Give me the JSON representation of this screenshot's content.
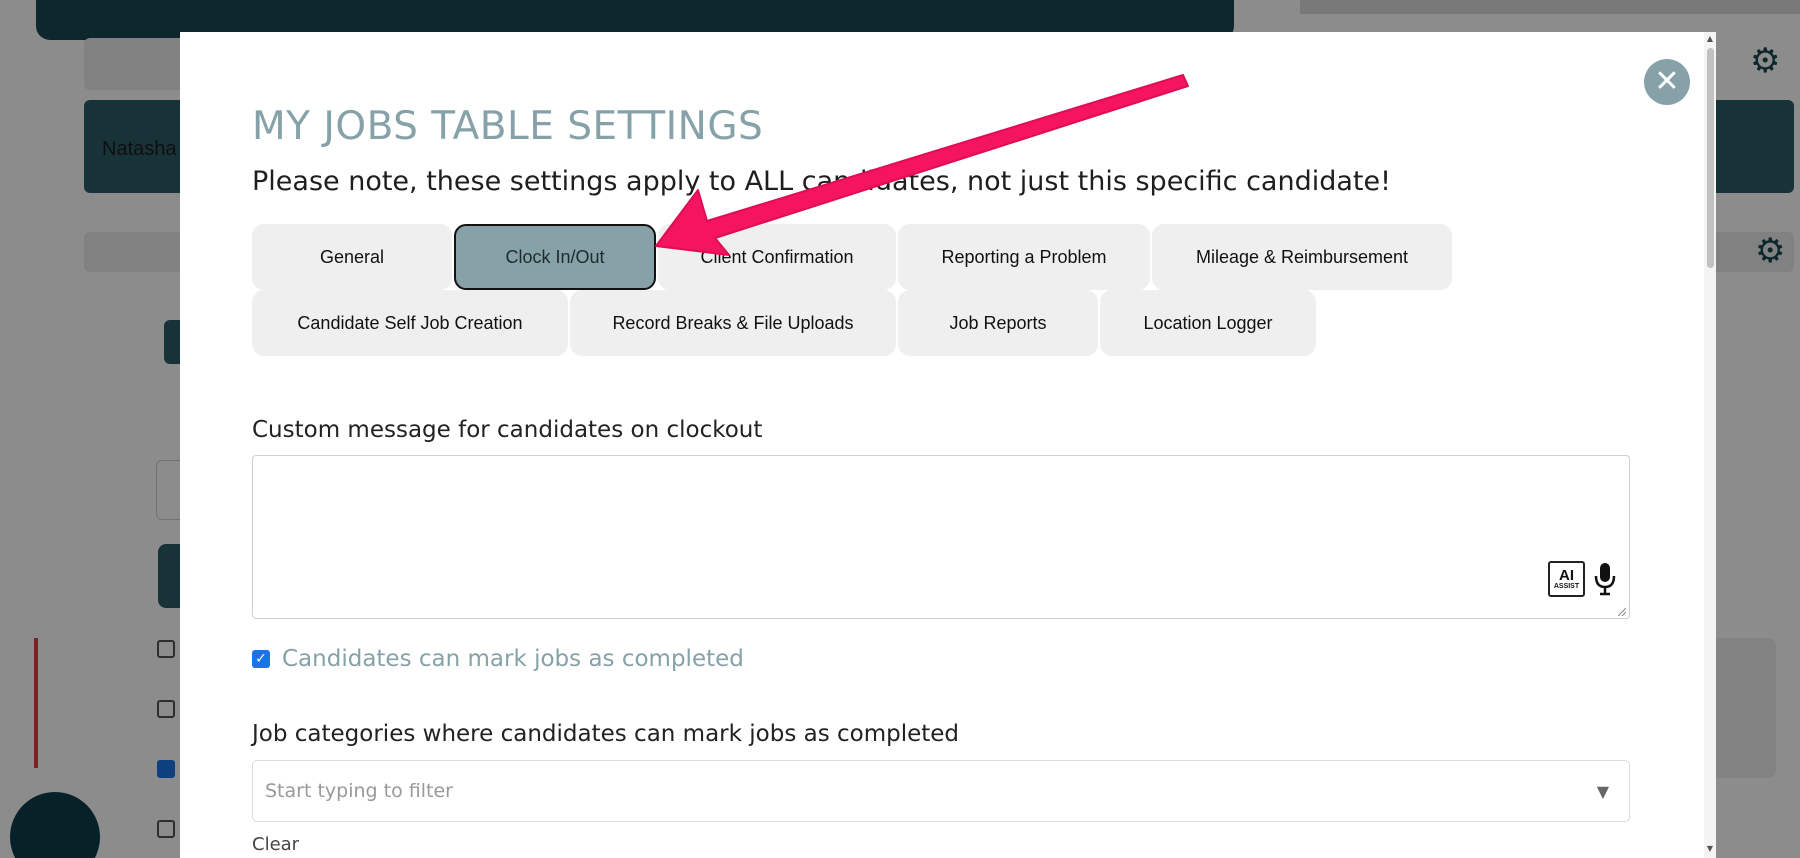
{
  "background": {
    "user_name": "Natasha",
    "gear_icon": "gear-icon"
  },
  "modal": {
    "title": "MY JOBS TABLE SETTINGS",
    "note": "Please note, these settings apply to ALL candidates, not just this specific candidate!",
    "close_icon": "close-icon",
    "tabs": [
      {
        "label": "General",
        "active": false
      },
      {
        "label": "Clock In/Out",
        "active": true
      },
      {
        "label": "Client Confirmation",
        "active": false
      },
      {
        "label": "Reporting a Problem",
        "active": false
      },
      {
        "label": "Mileage & Reimbursement",
        "active": false
      },
      {
        "label": "Candidate Self Job Creation",
        "active": false
      },
      {
        "label": "Record Breaks & File Uploads",
        "active": false
      },
      {
        "label": "Job Reports",
        "active": false
      },
      {
        "label": "Location Logger",
        "active": false
      }
    ],
    "custom_message": {
      "label": "Custom message for candidates on clockout",
      "value": "",
      "ai_assist_big": "AI",
      "ai_assist_small": "ASSIST"
    },
    "completed_checkbox": {
      "label": "Candidates can mark jobs as completed",
      "checked": true
    },
    "job_categories": {
      "label": "Job categories where candidates can mark jobs as completed",
      "placeholder": "Start typing to filter",
      "clear_label": "Clear"
    }
  },
  "colors": {
    "accent": "#86a2a8",
    "annotation_arrow": "#f4145f",
    "checkbox": "#1a73e8"
  }
}
